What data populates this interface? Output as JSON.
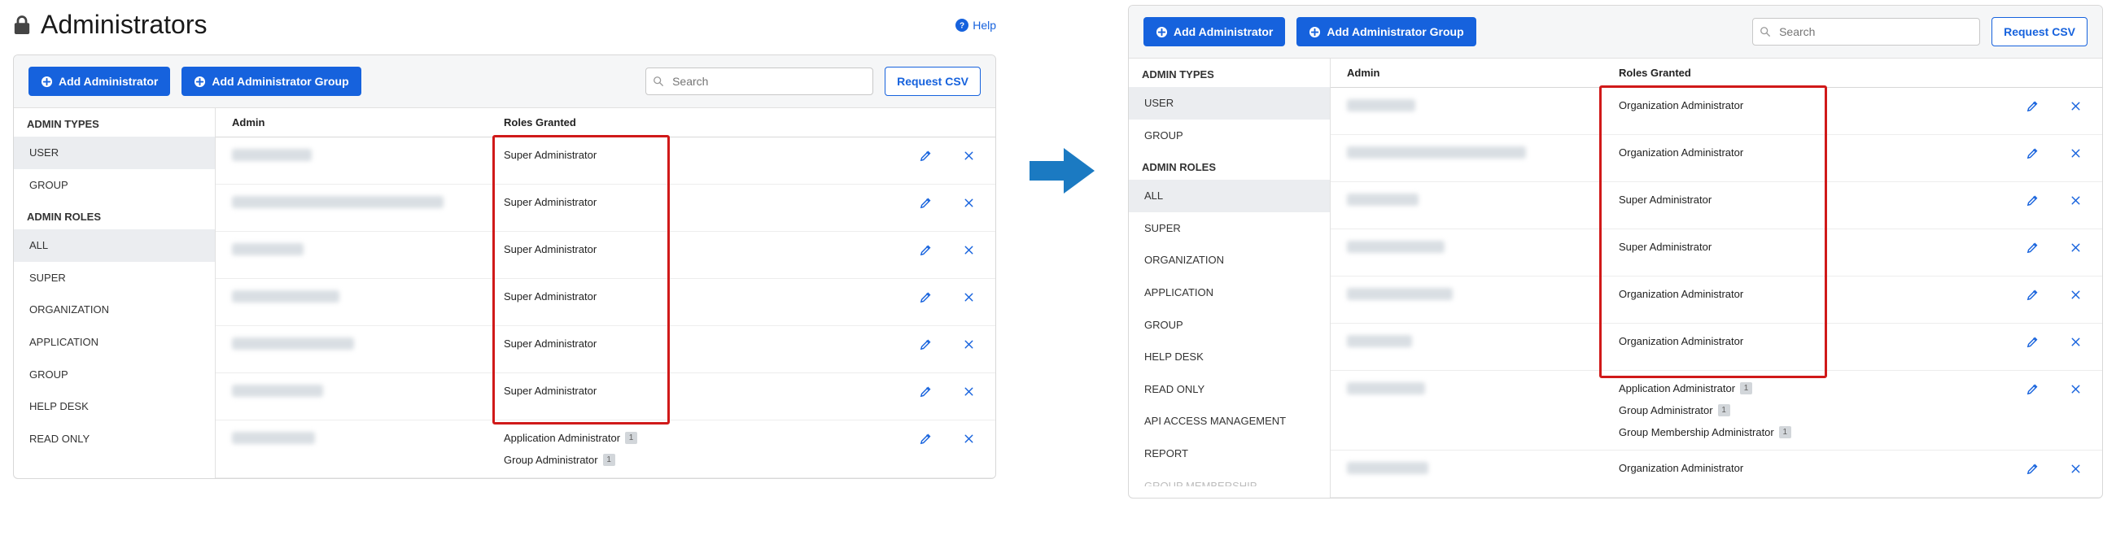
{
  "pageTitle": "Administrators",
  "helpLabel": "Help",
  "buttons": {
    "addAdmin": "Add Administrator",
    "addGroup": "Add Administrator Group",
    "requestCsv": "Request CSV"
  },
  "searchPlaceholder": "Search",
  "sidebar": {
    "typesHeading": "ADMIN TYPES",
    "rolesHeading": "ADMIN ROLES"
  },
  "tableHeaders": {
    "admin": "Admin",
    "roles": "Roles Granted"
  },
  "left": {
    "sidebarTypes": [
      {
        "label": "USER",
        "selected": true
      },
      {
        "label": "GROUP",
        "selected": false
      }
    ],
    "sidebarRoles": [
      {
        "label": "ALL",
        "selected": true
      },
      {
        "label": "SUPER",
        "selected": false
      },
      {
        "label": "ORGANIZATION",
        "selected": false
      },
      {
        "label": "APPLICATION",
        "selected": false
      },
      {
        "label": "GROUP",
        "selected": false
      },
      {
        "label": "HELP DESK",
        "selected": false
      },
      {
        "label": "READ ONLY",
        "selected": false
      }
    ],
    "rows": [
      {
        "blurW": 98,
        "roles": [
          {
            "text": "Super Administrator"
          }
        ]
      },
      {
        "blurW": 260,
        "roles": [
          {
            "text": "Super Administrator"
          }
        ]
      },
      {
        "blurW": 88,
        "roles": [
          {
            "text": "Super Administrator"
          }
        ]
      },
      {
        "blurW": 132,
        "roles": [
          {
            "text": "Super Administrator"
          }
        ]
      },
      {
        "blurW": 150,
        "roles": [
          {
            "text": "Super Administrator"
          }
        ]
      },
      {
        "blurW": 112,
        "roles": [
          {
            "text": "Super Administrator"
          }
        ]
      },
      {
        "blurW": 102,
        "roles": [
          {
            "text": "Application Administrator",
            "badge": "1"
          },
          {
            "text": "Group Administrator",
            "badge": "1"
          }
        ]
      }
    ]
  },
  "right": {
    "sidebarTypes": [
      {
        "label": "USER",
        "selected": true
      },
      {
        "label": "GROUP",
        "selected": false
      }
    ],
    "sidebarRoles": [
      {
        "label": "ALL",
        "selected": true
      },
      {
        "label": "SUPER",
        "selected": false
      },
      {
        "label": "ORGANIZATION",
        "selected": false
      },
      {
        "label": "APPLICATION",
        "selected": false
      },
      {
        "label": "GROUP",
        "selected": false
      },
      {
        "label": "HELP DESK",
        "selected": false
      },
      {
        "label": "READ ONLY",
        "selected": false
      },
      {
        "label": "API ACCESS MANAGEMENT",
        "selected": false
      },
      {
        "label": "REPORT",
        "selected": false
      },
      {
        "label": "GROUP MEMBERSHIP",
        "selected": false,
        "cut": true
      }
    ],
    "rows": [
      {
        "blurW": 84,
        "roles": [
          {
            "text": "Organization Administrator"
          }
        ]
      },
      {
        "blurW": 220,
        "roles": [
          {
            "text": "Organization Administrator"
          }
        ]
      },
      {
        "blurW": 88,
        "roles": [
          {
            "text": "Super Administrator"
          }
        ]
      },
      {
        "blurW": 120,
        "roles": [
          {
            "text": "Super Administrator"
          }
        ]
      },
      {
        "blurW": 130,
        "roles": [
          {
            "text": "Organization Administrator"
          }
        ]
      },
      {
        "blurW": 80,
        "roles": [
          {
            "text": "Organization Administrator"
          }
        ]
      },
      {
        "blurW": 96,
        "roles": [
          {
            "text": "Application Administrator",
            "badge": "1"
          },
          {
            "text": "Group Administrator",
            "badge": "1"
          },
          {
            "text": "Group Membership Administrator",
            "badge": "1"
          }
        ]
      },
      {
        "blurW": 100,
        "roles": [
          {
            "text": "Organization Administrator"
          }
        ]
      }
    ]
  }
}
